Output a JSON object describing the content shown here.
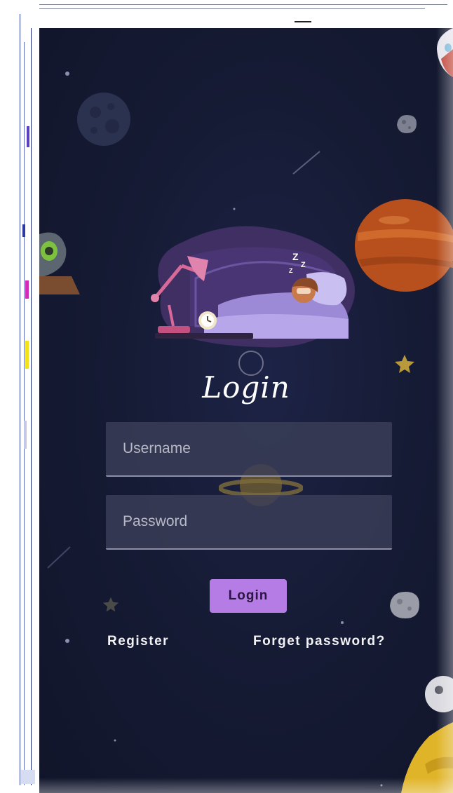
{
  "screen": {
    "title": "Login",
    "illustration_icon": "sleeping-person-icon"
  },
  "form": {
    "username": {
      "placeholder": "Username",
      "value": ""
    },
    "password": {
      "placeholder": "Password",
      "value": ""
    },
    "login_button_label": "Login"
  },
  "links": {
    "register_label": "Register",
    "forgot_password_label": "Forget password?"
  },
  "colors": {
    "background": "#161b35",
    "accent_button": "#b57ce6",
    "field_background": "#3a3e58",
    "text": "#ffffff"
  },
  "decorations": [
    "planet-icon",
    "rocket-icon",
    "alien-icon",
    "star-icon",
    "asteroid-icon",
    "ringed-planet-icon",
    "moon-icon"
  ]
}
